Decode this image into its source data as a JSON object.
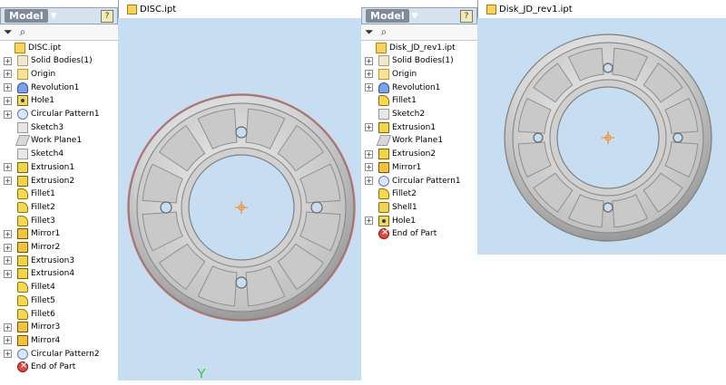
{
  "left": {
    "model_title": "Model",
    "help": "?",
    "tab_title": "DISC.ipt",
    "tree": [
      {
        "label": "DISC.ipt",
        "type": "part",
        "expander": "",
        "indent": 0
      },
      {
        "label": "Solid Bodies(1)",
        "type": "body",
        "expander": "+",
        "indent": 1
      },
      {
        "label": "Origin",
        "type": "folder",
        "expander": "+",
        "indent": 1
      },
      {
        "label": "Revolution1",
        "type": "revolution",
        "expander": "+",
        "indent": 1
      },
      {
        "label": "Hole1",
        "type": "hole",
        "expander": "+",
        "indent": 1
      },
      {
        "label": "Circular Pattern1",
        "type": "circular",
        "expander": "+",
        "indent": 1
      },
      {
        "label": "Sketch3",
        "type": "sketch",
        "expander": "",
        "indent": 1
      },
      {
        "label": "Work Plane1",
        "type": "plane",
        "expander": "",
        "indent": 1
      },
      {
        "label": "Sketch4",
        "type": "sketch",
        "expander": "",
        "indent": 1
      },
      {
        "label": "Extrusion1",
        "type": "extrusion",
        "expander": "+",
        "indent": 1
      },
      {
        "label": "Extrusion2",
        "type": "extrusion",
        "expander": "+",
        "indent": 1
      },
      {
        "label": "Fillet1",
        "type": "fillet",
        "expander": "",
        "indent": 1
      },
      {
        "label": "Fillet2",
        "type": "fillet",
        "expander": "",
        "indent": 1
      },
      {
        "label": "Fillet3",
        "type": "fillet",
        "expander": "",
        "indent": 1
      },
      {
        "label": "Mirror1",
        "type": "mirror",
        "expander": "+",
        "indent": 1
      },
      {
        "label": "Mirror2",
        "type": "mirror",
        "expander": "+",
        "indent": 1
      },
      {
        "label": "Extrusion3",
        "type": "extrusion",
        "expander": "+",
        "indent": 1
      },
      {
        "label": "Extrusion4",
        "type": "extrusion",
        "expander": "+",
        "indent": 1
      },
      {
        "label": "Fillet4",
        "type": "fillet",
        "expander": "",
        "indent": 1
      },
      {
        "label": "Fillet5",
        "type": "fillet",
        "expander": "",
        "indent": 1
      },
      {
        "label": "Fillet6",
        "type": "fillet",
        "expander": "",
        "indent": 1
      },
      {
        "label": "Mirror3",
        "type": "mirror",
        "expander": "+",
        "indent": 1
      },
      {
        "label": "Mirror4",
        "type": "mirror",
        "expander": "+",
        "indent": 1
      },
      {
        "label": "Circular Pattern2",
        "type": "circular",
        "expander": "+",
        "indent": 1
      },
      {
        "label": "End of Part",
        "type": "end",
        "expander": "",
        "indent": 1
      }
    ],
    "axis_label": "Y"
  },
  "right": {
    "model_title": "Model",
    "help": "?",
    "tab_title": "Disk_JD_rev1.ipt",
    "tree": [
      {
        "label": "Disk_JD_rev1.ipt",
        "type": "part",
        "expander": "",
        "indent": 0
      },
      {
        "label": "Solid Bodies(1)",
        "type": "body",
        "expander": "+",
        "indent": 1
      },
      {
        "label": "Origin",
        "type": "folder",
        "expander": "+",
        "indent": 1
      },
      {
        "label": "Revolution1",
        "type": "revolution",
        "expander": "+",
        "indent": 1
      },
      {
        "label": "Fillet1",
        "type": "fillet",
        "expander": "",
        "indent": 1
      },
      {
        "label": "Sketch2",
        "type": "sketch",
        "expander": "",
        "indent": 1
      },
      {
        "label": "Extrusion1",
        "type": "extrusion",
        "expander": "+",
        "indent": 1
      },
      {
        "label": "Work Plane1",
        "type": "plane",
        "expander": "",
        "indent": 1
      },
      {
        "label": "Extrusion2",
        "type": "extrusion",
        "expander": "+",
        "indent": 1
      },
      {
        "label": "Mirror1",
        "type": "mirror",
        "expander": "+",
        "indent": 1
      },
      {
        "label": "Circular Pattern1",
        "type": "circular",
        "expander": "+",
        "indent": 1
      },
      {
        "label": "Fillet2",
        "type": "fillet",
        "expander": "",
        "indent": 1
      },
      {
        "label": "Shell1",
        "type": "shell",
        "expander": "",
        "indent": 1
      },
      {
        "label": "Hole1",
        "type": "hole",
        "expander": "+",
        "indent": 1
      },
      {
        "label": "End of Part",
        "type": "end",
        "expander": "",
        "indent": 1
      }
    ]
  },
  "colors": {
    "viewport_bg": "#c7def2",
    "disc_shadow": "#909090",
    "disc_light": "#f2f2f2",
    "rim_highlight": "#dd6c6c",
    "center_mark": "#f58d24",
    "axis_label": "#38c23d"
  }
}
